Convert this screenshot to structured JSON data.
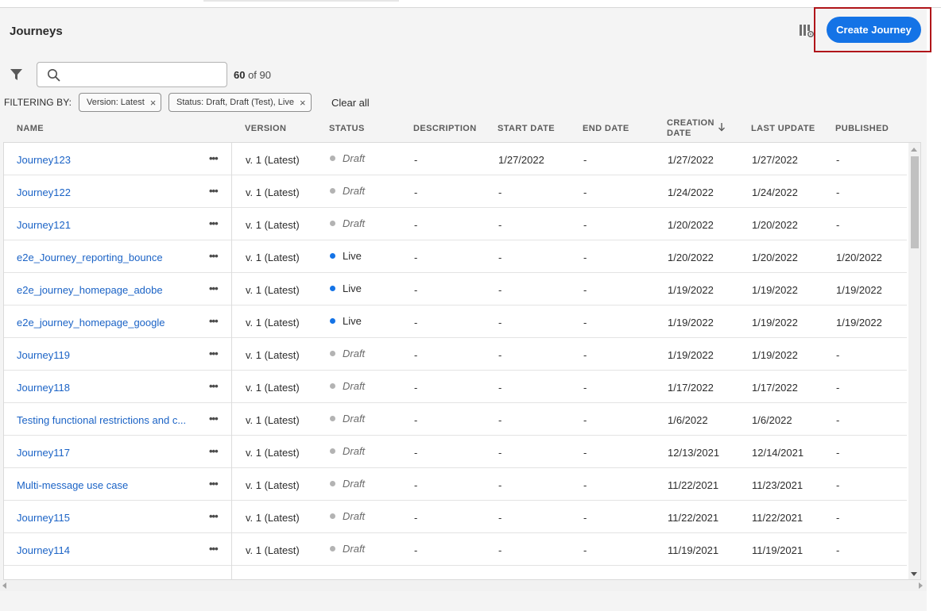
{
  "header": {
    "title": "Journeys",
    "create_button": "Create Journey"
  },
  "toolbar": {
    "search_placeholder": "",
    "count_shown": "60",
    "count_of": " of 90"
  },
  "filters": {
    "label": "FILTERING BY:",
    "chips": [
      "Version: Latest",
      "Status: Draft, Draft (Test), Live"
    ],
    "remove_glyph": "×",
    "clear_all": "Clear all"
  },
  "columns": {
    "name": "NAME",
    "version": "VERSION",
    "status": "STATUS",
    "description": "DESCRIPTION",
    "start_date": "START DATE",
    "end_date": "END DATE",
    "creation_date_1": "CREATION",
    "creation_date_2": "DATE",
    "last_update": "LAST UPDATE",
    "published": "PUBLISHED"
  },
  "sort": {
    "column": "creation_date",
    "direction": "descending",
    "icon": "arrow-down-icon"
  },
  "colors": {
    "accent": "#1473e6",
    "link": "#1b63c6",
    "live_dot": "#1473e6",
    "draft_dot": "#b3b3b3",
    "highlight_border": "#b0151a"
  },
  "more_glyph": "•••",
  "rows": [
    {
      "name": "Journey123",
      "version": "v. 1 (Latest)",
      "status": "Draft",
      "description": "-",
      "start_date": "1/27/2022",
      "end_date": "-",
      "creation_date": "1/27/2022",
      "last_update": "1/27/2022",
      "published": "-"
    },
    {
      "name": "Journey122",
      "version": "v. 1 (Latest)",
      "status": "Draft",
      "description": "-",
      "start_date": "-",
      "end_date": "-",
      "creation_date": "1/24/2022",
      "last_update": "1/24/2022",
      "published": "-"
    },
    {
      "name": "Journey121",
      "version": "v. 1 (Latest)",
      "status": "Draft",
      "description": "-",
      "start_date": "-",
      "end_date": "-",
      "creation_date": "1/20/2022",
      "last_update": "1/20/2022",
      "published": "-"
    },
    {
      "name": "e2e_Journey_reporting_bounce",
      "version": "v. 1 (Latest)",
      "status": "Live",
      "description": "-",
      "start_date": "-",
      "end_date": "-",
      "creation_date": "1/20/2022",
      "last_update": "1/20/2022",
      "published": "1/20/2022"
    },
    {
      "name": "e2e_journey_homepage_adobe",
      "version": "v. 1 (Latest)",
      "status": "Live",
      "description": "-",
      "start_date": "-",
      "end_date": "-",
      "creation_date": "1/19/2022",
      "last_update": "1/19/2022",
      "published": "1/19/2022"
    },
    {
      "name": "e2e_journey_homepage_google",
      "version": "v. 1 (Latest)",
      "status": "Live",
      "description": "-",
      "start_date": "-",
      "end_date": "-",
      "creation_date": "1/19/2022",
      "last_update": "1/19/2022",
      "published": "1/19/2022"
    },
    {
      "name": "Journey119",
      "version": "v. 1 (Latest)",
      "status": "Draft",
      "description": "-",
      "start_date": "-",
      "end_date": "-",
      "creation_date": "1/19/2022",
      "last_update": "1/19/2022",
      "published": "-"
    },
    {
      "name": "Journey118",
      "version": "v. 1 (Latest)",
      "status": "Draft",
      "description": "-",
      "start_date": "-",
      "end_date": "-",
      "creation_date": "1/17/2022",
      "last_update": "1/17/2022",
      "published": "-"
    },
    {
      "name": "Testing functional restrictions and c...",
      "version": "v. 1 (Latest)",
      "status": "Draft",
      "description": "-",
      "start_date": "-",
      "end_date": "-",
      "creation_date": "1/6/2022",
      "last_update": "1/6/2022",
      "published": "-"
    },
    {
      "name": "Journey117",
      "version": "v. 1 (Latest)",
      "status": "Draft",
      "description": "-",
      "start_date": "-",
      "end_date": "-",
      "creation_date": "12/13/2021",
      "last_update": "12/14/2021",
      "published": "-"
    },
    {
      "name": "Multi-message use case",
      "version": "v. 1 (Latest)",
      "status": "Draft",
      "description": "-",
      "start_date": "-",
      "end_date": "-",
      "creation_date": "11/22/2021",
      "last_update": "11/23/2021",
      "published": "-"
    },
    {
      "name": "Journey115",
      "version": "v. 1 (Latest)",
      "status": "Draft",
      "description": "-",
      "start_date": "-",
      "end_date": "-",
      "creation_date": "11/22/2021",
      "last_update": "11/22/2021",
      "published": "-"
    },
    {
      "name": "Journey114",
      "version": "v. 1 (Latest)",
      "status": "Draft",
      "description": "-",
      "start_date": "-",
      "end_date": "-",
      "creation_date": "11/19/2021",
      "last_update": "11/19/2021",
      "published": "-"
    }
  ]
}
